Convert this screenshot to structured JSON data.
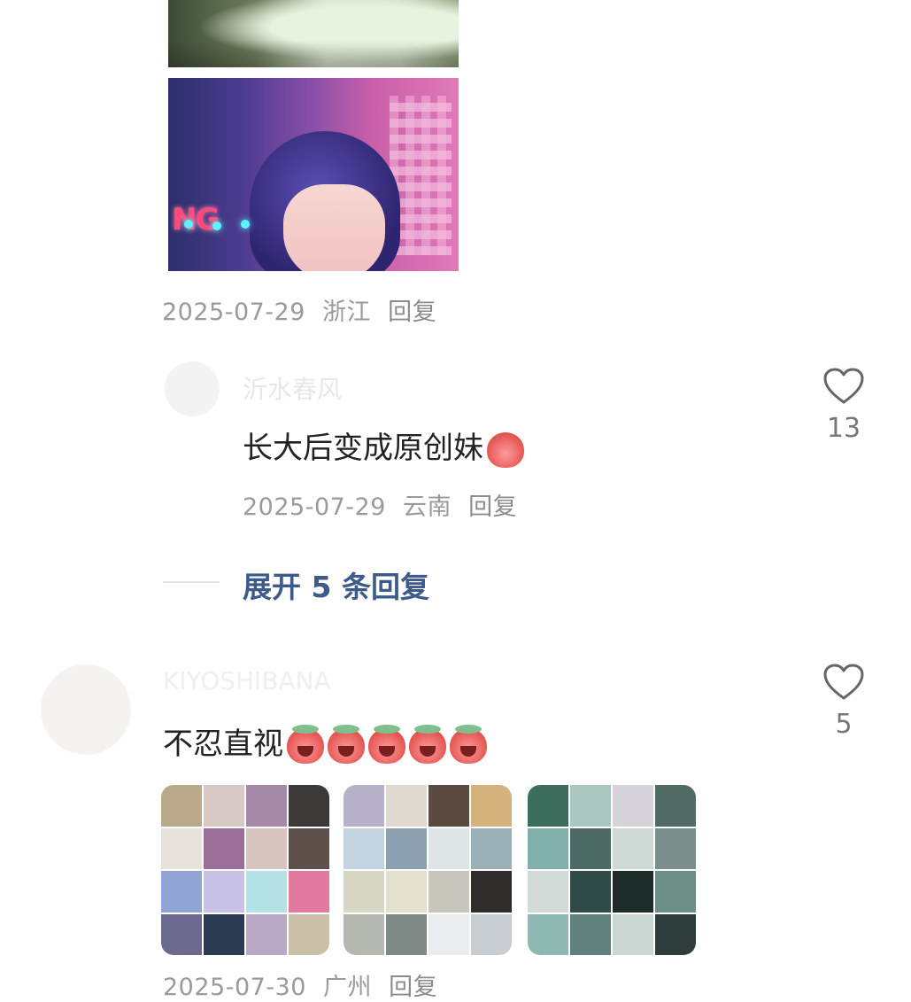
{
  "comment1": {
    "date": "2025-07-29",
    "location": "浙江",
    "reply_label": "回复"
  },
  "reply1": {
    "username": "沂水春风",
    "text": "长大后变成原创妹",
    "date": "2025-07-29",
    "location": "云南",
    "reply_label": "回复",
    "like_count": "13"
  },
  "expand": {
    "label": "展开 5 条回复"
  },
  "comment2": {
    "username": "KIYOSHIBANA",
    "text": "不忍直视",
    "like_count": "5",
    "date": "2025-07-30",
    "location": "广州",
    "reply_label": "回复"
  },
  "icons": {
    "like": "heart-outline-icon",
    "thumbs_up_emoji": "thumbs-up-emoji",
    "crying_emoji": "crying-emoji"
  },
  "colors": {
    "expand_link": "#3c5b8a",
    "meta_text": "#9a9a9a"
  }
}
